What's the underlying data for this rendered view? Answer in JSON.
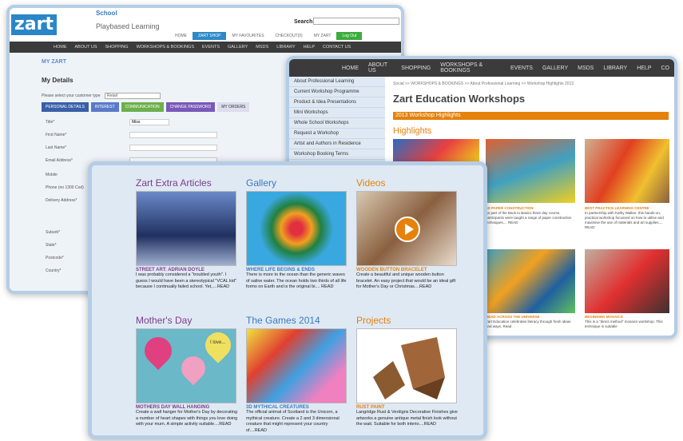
{
  "window1": {
    "logo": "zart",
    "school": "School",
    "tagline": "Playbased Learning",
    "search_label": "Search",
    "topnav": [
      "HOME",
      "ZART SHOP",
      "MY FAVOURITES",
      "CHECKOUT(0)",
      "MY ZART",
      "Log Out"
    ],
    "nav": [
      "HOME",
      "ABOUT US",
      "SHOPPING",
      "WORKSHOPS & BOOKINGS",
      "EVENTS",
      "GALLERY",
      "MSDS",
      "LIBRARY",
      "HELP",
      "CONTACT US"
    ],
    "my_zart": "MY ZART",
    "my_details": "My Details",
    "customer_type_label": "Please select your customer type",
    "customer_type_value": "Retail",
    "tabs": [
      "PERSONAL DETAILS",
      "INTEREST",
      "COMMUNICATION",
      "CHANGE PASSWORD",
      "MY ORDERS"
    ],
    "fields": [
      "Title*",
      "First Name*",
      "Last Name*",
      "Email Address*",
      "Mobile",
      "Phone (no 1300 Cod)",
      "Delivery Address*",
      "Suburb*",
      "State*",
      "Postcode*",
      "Country*"
    ],
    "title_value": "Miss"
  },
  "window2": {
    "nav": [
      "HOME",
      "ABOUT US",
      "SHOPPING",
      "WORKSHOPS & BOOKINGS",
      "EVENTS",
      "GALLERY",
      "MSDS",
      "LIBRARY",
      "HELP",
      "CO"
    ],
    "sidebar": [
      "About Professional Learning",
      "Current Workshop Programme",
      "Product & Idea Presentations",
      "Mini Workshops",
      "Whole School Workshops",
      "Request a Workshop",
      "Artist and Authors in Residence",
      "Workshop Booking Terms"
    ],
    "breadcrumb": "Social >> WORKSHOPS & BOOKINGS >> About Professional Learning >> Workshop Highlights 2013",
    "heading": "Zart Education Workshops",
    "banner": "2013 Workshop Highlights",
    "highlights": "Highlights",
    "items": [
      {
        "title": "",
        "desc": ""
      },
      {
        "title": "3D PAPER CONSTRUCTION",
        "desc": "As part of the Back to Basics three day course, participants were taught a range of paper construction techniques.... READ"
      },
      {
        "title": "BEST PRACTICE LEARNING CENTRE",
        "desc": "In partnership with Kathy Walker, this hands-on, practical workshop focussed on how to utilise and maximise the use of materials and art supplies.... READ"
      },
      {
        "title": "",
        "desc": ""
      },
      {
        "title": "READ ACROSS THE UNIVERSE",
        "desc": "Zart Education celebrates literacy through fresh ideas and ways. Read"
      },
      {
        "title": "BEGINNING MOSAICS",
        "desc": "This is a \"direct method\" mosaics workshop. This technique is suitable"
      }
    ]
  },
  "window3": {
    "columns": [
      {
        "title": "Zart Extra Articles",
        "label": "STREET ART: ADRIAN DOYLE",
        "desc": "I was probably considered a \"troubled youth\". I guess I would have been a stereotypical \"VCAL kid\" because I continually failed school. Yet,....READ"
      },
      {
        "title": "Gallery",
        "label": "WHERE LIFE BEGINS & ENDS",
        "desc": "There is more to the ocean than the generic waves of saline water. The ocean holds two thirds of all life forms on Earth and is the original bi.... READ"
      },
      {
        "title": "Videos",
        "label": "WOODEN BUTTON BRACELET",
        "desc": "Create a beautiful and unique wooden button bracelet. An easy project that would be an ideal gift for Mother's Day or Christmas....READ"
      },
      {
        "title": "Mother's Day",
        "label": "MOTHERS DAY WALL HANGING",
        "desc": "Create a wall hanger for Mother's Day by decorating a number of heart shapes with things you love doing with your mum. A simple activity suitable....READ"
      },
      {
        "title": "The Games 2014",
        "label": "3D MYTHICAL CREATURES",
        "desc": "The official animal of Scotland is the Unicorn, a mythical creature. Create a 2 and 3 dimensional creature that might represent your country of....READ"
      },
      {
        "title": "Projects",
        "label": "RUST PAINT",
        "desc": "Langridge Rust & Verdigris Decorative Finishes give artworks a genuine antique metal finish look without the wait. Suitable for both interio....READ"
      }
    ],
    "heart_text": "I love..."
  }
}
